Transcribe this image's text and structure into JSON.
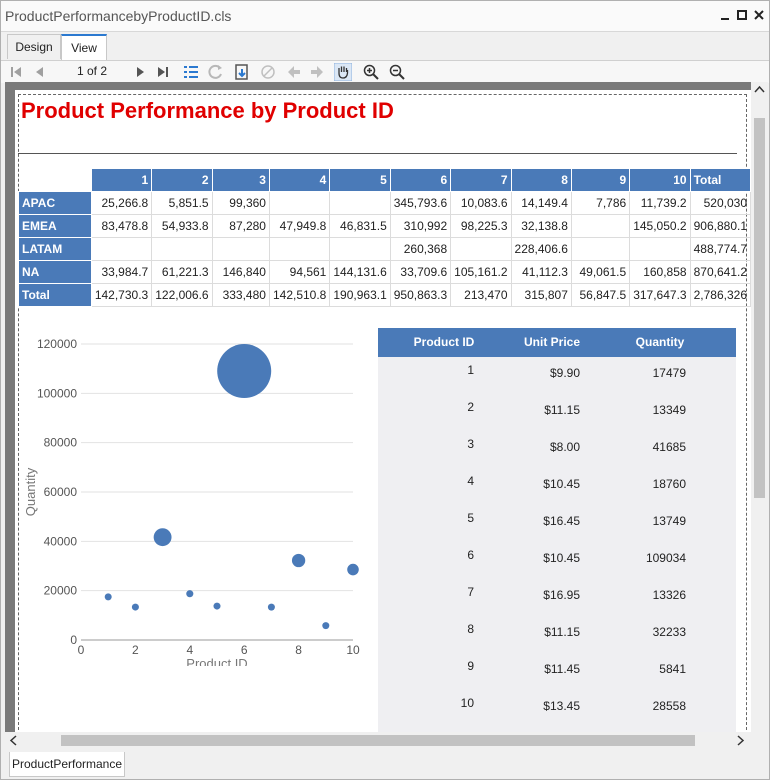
{
  "window": {
    "title": "ProductPerformancebyProductID.cls"
  },
  "tabs": [
    {
      "label": "Design"
    },
    {
      "label": "View"
    }
  ],
  "toolbar": {
    "page_info": "1 of 2"
  },
  "report": {
    "title": "Product Performance by Product ID",
    "crosstab": {
      "columns": [
        "1",
        "2",
        "3",
        "4",
        "5",
        "6",
        "7",
        "8",
        "9",
        "10",
        "Total"
      ],
      "rows": [
        {
          "label": "APAC",
          "cells": [
            "25,266.8",
            "5,851.5",
            "99,360",
            "",
            "",
            "345,793.6",
            "10,083.6",
            "14,149.4",
            "7,786",
            "11,739.2",
            "520,030"
          ]
        },
        {
          "label": "EMEA",
          "cells": [
            "83,478.8",
            "54,933.8",
            "87,280",
            "47,949.8",
            "46,831.5",
            "310,992",
            "98,225.3",
            "32,138.8",
            "",
            "145,050.2",
            "906,880.1"
          ]
        },
        {
          "label": "LATAM",
          "cells": [
            "",
            "",
            "",
            "",
            "",
            "260,368",
            "",
            "228,406.6",
            "",
            "",
            "488,774.7"
          ]
        },
        {
          "label": "NA",
          "cells": [
            "33,984.7",
            "61,221.3",
            "146,840",
            "94,561",
            "144,131.6",
            "33,709.6",
            "105,161.2",
            "41,112.3",
            "49,061.5",
            "160,858",
            "870,641.2"
          ]
        },
        {
          "label": "Total",
          "cells": [
            "142,730.3",
            "122,006.6",
            "333,480",
            "142,510.8",
            "190,963.1",
            "950,863.3",
            "213,470",
            "315,807",
            "56,847.5",
            "317,647.3",
            "2,786,326"
          ]
        }
      ]
    },
    "product_list": {
      "headers": [
        "Product ID",
        "Unit Price",
        "Quantity"
      ],
      "rows": [
        {
          "id": "1",
          "price": "$9.90",
          "qty": "17479"
        },
        {
          "id": "2",
          "price": "$11.15",
          "qty": "13349"
        },
        {
          "id": "3",
          "price": "$8.00",
          "qty": "41685"
        },
        {
          "id": "4",
          "price": "$10.45",
          "qty": "18760"
        },
        {
          "id": "5",
          "price": "$16.45",
          "qty": "13749"
        },
        {
          "id": "6",
          "price": "$10.45",
          "qty": "109034"
        },
        {
          "id": "7",
          "price": "$16.95",
          "qty": "13326"
        },
        {
          "id": "8",
          "price": "$11.15",
          "qty": "32233"
        },
        {
          "id": "9",
          "price": "$11.45",
          "qty": "5841"
        },
        {
          "id": "10",
          "price": "$13.45",
          "qty": "28558"
        }
      ]
    }
  },
  "chart_data": {
    "type": "scatter",
    "xlabel": "Product ID",
    "ylabel": "Quantity",
    "xlim": [
      0,
      10
    ],
    "ylim": [
      0,
      120000
    ],
    "xticks": [
      0,
      2,
      4,
      6,
      8,
      10
    ],
    "yticks": [
      0,
      20000,
      40000,
      60000,
      80000,
      100000,
      120000
    ],
    "grid": true,
    "legend": "none",
    "color": "#4a7ab8",
    "points": [
      {
        "x": 1,
        "y": 17479,
        "size": 9.9
      },
      {
        "x": 2,
        "y": 13349,
        "size": 11.15
      },
      {
        "x": 3,
        "y": 41685,
        "size": 8.0
      },
      {
        "x": 4,
        "y": 18760,
        "size": 10.45
      },
      {
        "x": 5,
        "y": 13749,
        "size": 16.45
      },
      {
        "x": 6,
        "y": 109034,
        "size": 10.45
      },
      {
        "x": 7,
        "y": 13326,
        "size": 16.95
      },
      {
        "x": 8,
        "y": 32233,
        "size": 11.15
      },
      {
        "x": 9,
        "y": 5841,
        "size": 11.45
      },
      {
        "x": 10,
        "y": 28558,
        "size": 13.45
      }
    ]
  },
  "bottom_tab": {
    "label": "ProductPerformance"
  },
  "colors": {
    "header_blue": "#4a7ab8",
    "title_red": "#e00000"
  }
}
